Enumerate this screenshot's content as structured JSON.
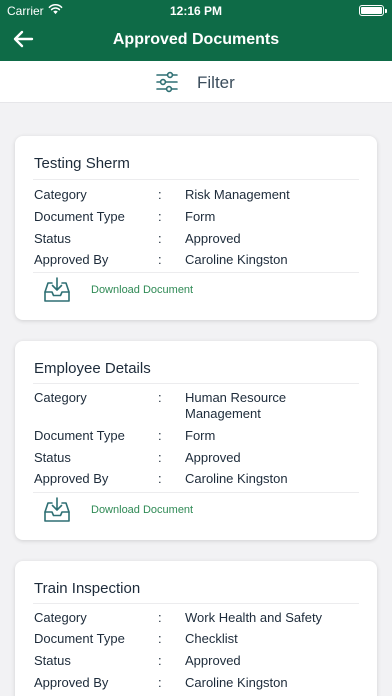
{
  "status_bar": {
    "carrier": "Carrier",
    "time": "12:16 PM"
  },
  "header": {
    "title": "Approved Documents",
    "back_icon": "arrow-left-icon"
  },
  "filter": {
    "label": "Filter",
    "icon": "sliders-icon"
  },
  "field_labels": {
    "category": "Category",
    "document_type": "Document Type",
    "status": "Status",
    "approved_by": "Approved By",
    "separator": ":"
  },
  "download_label": "Download Document",
  "documents": [
    {
      "title": "Testing Sherm",
      "category": "Risk Management",
      "document_type": "Form",
      "status": "Approved",
      "approved_by": "Caroline Kingston"
    },
    {
      "title": "Employee Details",
      "category": "Human Resource Management",
      "document_type": "Form",
      "status": "Approved",
      "approved_by": "Caroline Kingston"
    },
    {
      "title": "Train Inspection",
      "category": "Work Health and Safety",
      "document_type": "Checklist",
      "status": "Approved",
      "approved_by": "Caroline Kingston"
    }
  ],
  "colors": {
    "brand_green": "#0e6b47",
    "link_green": "#2f8a55",
    "icon_teal": "#2e6f73"
  }
}
